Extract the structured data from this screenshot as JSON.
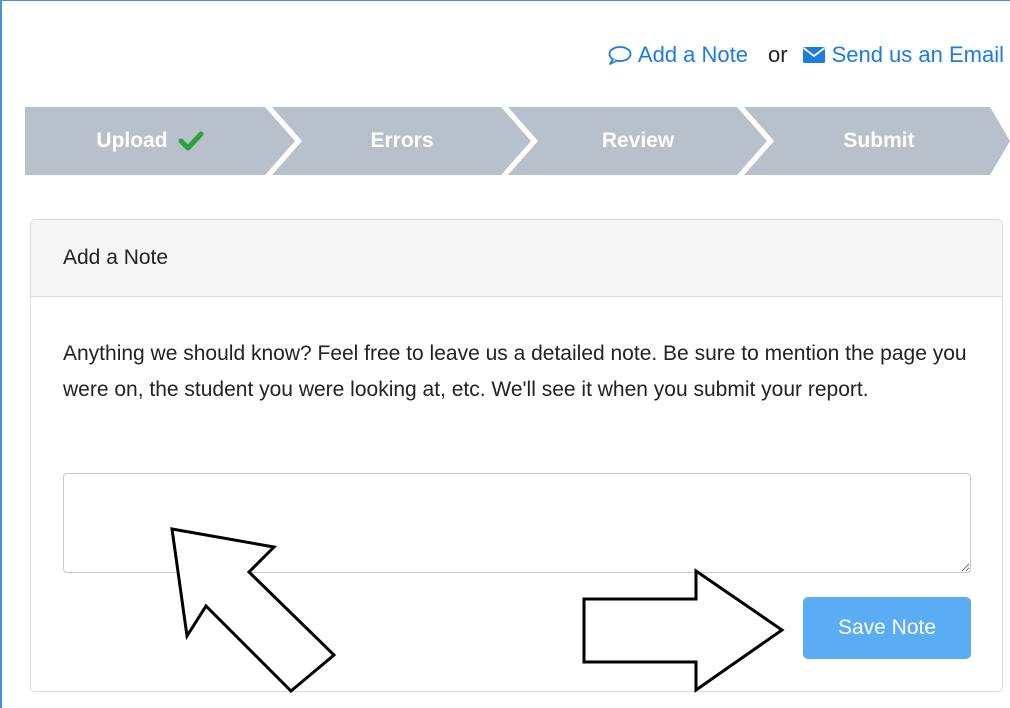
{
  "top_links": {
    "add_note": "Add a Note",
    "or": "or",
    "send_email": "Send us an Email",
    "add_note_icon": "speech-bubble-icon",
    "email_icon": "envelope-icon"
  },
  "stepper": {
    "steps": [
      {
        "label": "Upload",
        "completed": true
      },
      {
        "label": "Errors",
        "completed": false
      },
      {
        "label": "Review",
        "completed": false
      },
      {
        "label": "Submit",
        "completed": false
      }
    ],
    "check_color": "#2aa33b",
    "step_color": "#b8c0cb"
  },
  "note_panel": {
    "title": "Add a Note",
    "description": "Anything we should know? Feel free to leave us a detailed note. Be sure to mention the page you were on, the student you were looking at, etc. We'll see it when you submit your report.",
    "textarea_value": "",
    "save_button": "Save Note"
  },
  "colors": {
    "link": "#1e7be0",
    "button": "#5aacf5"
  }
}
